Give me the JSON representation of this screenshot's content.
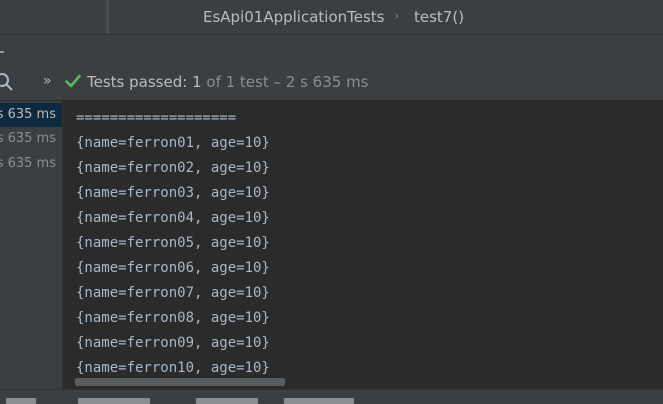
{
  "breadcrumb": {
    "file": "EsApi01ApplicationTests",
    "separator": "›",
    "method": "test7()"
  },
  "status": {
    "label": "Tests passed:",
    "passed": "1",
    "rest": "of 1 test – 2 s 635 ms"
  },
  "tree": {
    "items": [
      {
        "label": "s 635 ms",
        "selected": true
      },
      {
        "label": "s 635 ms",
        "selected": false
      },
      {
        "label": "s 635 ms",
        "selected": false
      }
    ]
  },
  "console": {
    "lines": [
      "===================",
      "{name=ferron01, age=10}",
      "{name=ferron02, age=10}",
      "{name=ferron03, age=10}",
      "{name=ferron04, age=10}",
      "{name=ferron05, age=10}",
      "{name=ferron06, age=10}",
      "{name=ferron07, age=10}",
      "{name=ferron08, age=10}",
      "{name=ferron09, age=10}",
      "{name=ferron10, age=10}"
    ]
  },
  "colors": {
    "success": "#5fb85f",
    "selection": "#0d293e"
  },
  "icons": {
    "search": "search-icon",
    "expand": "expand-chevrons-icon",
    "status": "check-icon"
  }
}
